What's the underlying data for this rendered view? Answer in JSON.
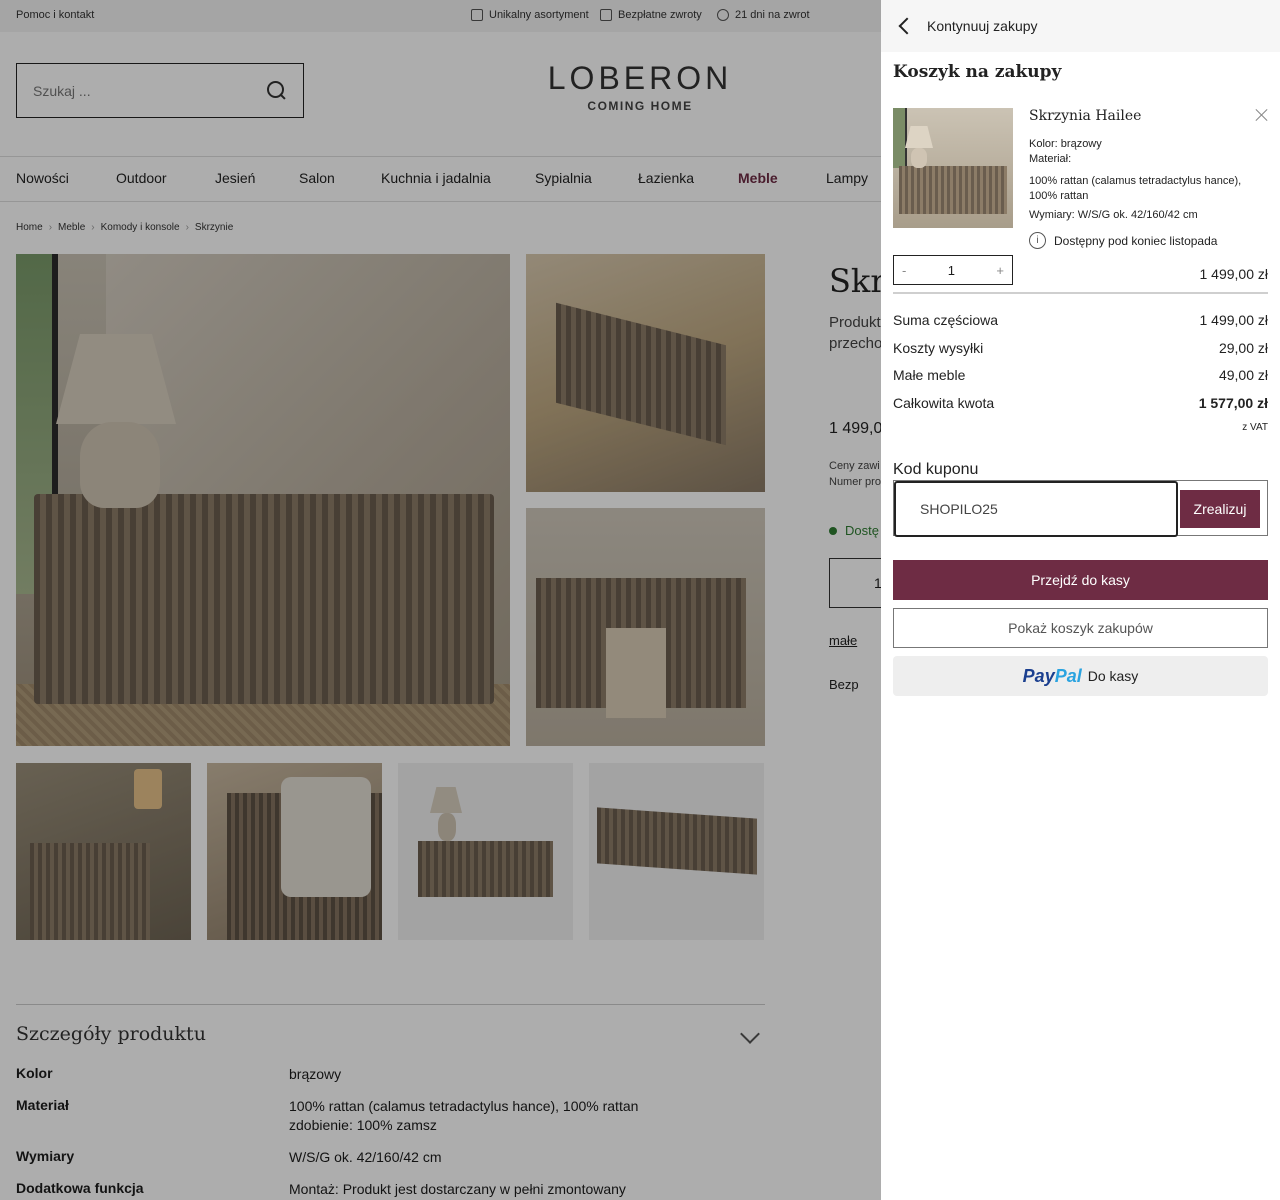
{
  "topbar": {
    "help": "Pomoc i kontakt",
    "usp": [
      "Unikalny asortyment",
      "Bezpłatne zwroty",
      "21 dni na zwrot"
    ]
  },
  "header": {
    "search_placeholder": "Szukaj ...",
    "logo_brand": "LOBERON",
    "logo_tag": "COMING HOME"
  },
  "nav": {
    "items": [
      "Nowości",
      "Outdoor",
      "Jesień",
      "Salon",
      "Kuchnia i jadalnia",
      "Sypialnia",
      "Łazienka",
      "Meble",
      "Lampy"
    ],
    "active": "Meble"
  },
  "breadcrumb": [
    "Home",
    "Meble",
    "Komody i konsole",
    "Skrzynie"
  ],
  "product": {
    "title": "Skrz",
    "subtitle_lines": [
      "Produkt",
      "przecho"
    ],
    "price": "1 499,0",
    "vat_lines": [
      "Ceny zawi",
      "Numer pro"
    ],
    "stock": "Dostę",
    "qty": "1",
    "link": "małe",
    "returns": "Bezp"
  },
  "details": {
    "heading": "Szczegóły produktu",
    "specs": [
      {
        "key": "Kolor",
        "value": "brązowy"
      },
      {
        "key": "Materiał",
        "value": "100% rattan (calamus tetradactylus hance), 100% rattan zdobienie: 100% zamsz"
      },
      {
        "key": "Wymiary",
        "value": "W/S/G ok. 42/160/42 cm"
      },
      {
        "key": "Dodatkowa funkcja",
        "value": "Montaż: Produkt jest dostarczany w pełni zmontowany"
      }
    ]
  },
  "cart": {
    "back_label": "Kontynuuj zakupy",
    "title": "Koszyk na zakupy",
    "item": {
      "name": "Skrzynia Hailee",
      "color": "Kolor: brązowy",
      "material_label": "Materiał:",
      "material": "100% rattan (calamus tetradactylus hance), 100% rattan",
      "dimensions": "Wymiary: W/S/G ok. 42/160/42 cm",
      "availability": "Dostępny pod koniec listopada",
      "qty": "1",
      "qty_minus": "-",
      "qty_plus": "+",
      "price": "1 499,00 zł"
    },
    "summary": [
      {
        "label": "Suma częściowa",
        "value": "1 499,00 zł"
      },
      {
        "label": "Koszty wysyłki",
        "value": "29,00 zł"
      },
      {
        "label": "Małe meble",
        "value": "49,00 zł"
      },
      {
        "label": "Całkowita kwota",
        "value": "1 577,00 zł"
      }
    ],
    "vat_note": "z VAT",
    "coupon_label": "Kod kuponu",
    "coupon_value": "SHOPILO25",
    "coupon_button": "Zrealizuj",
    "checkout_button": "Przejdź do kasy",
    "show_cart_button": "Pokaż koszyk zakupów",
    "paypal_pay": "Pay",
    "paypal_pal": "Pal",
    "paypal_label": "Do kasy"
  },
  "colors": {
    "accent": "#6e2c44",
    "stock_green": "#2e7d32",
    "paypal_dark": "#1b3f8f",
    "paypal_light": "#2aa3e0"
  }
}
